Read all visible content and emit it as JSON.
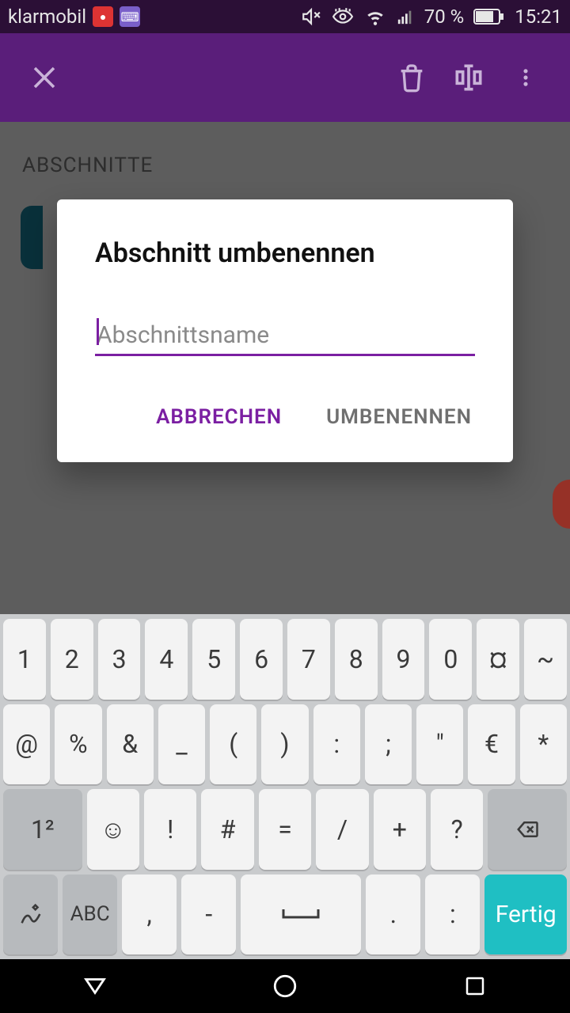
{
  "status": {
    "carrier": "klarmobil",
    "battery": "70 %",
    "time": "15:21"
  },
  "page": {
    "section_header": "ABSCHNITTE"
  },
  "dialog": {
    "title": "Abschnitt umbenennen",
    "placeholder": "Abschnittsname",
    "value": "",
    "cancel": "ABBRECHEN",
    "confirm": "UMBENENNEN"
  },
  "keyboard": {
    "row1": [
      "1",
      "2",
      "3",
      "4",
      "5",
      "6",
      "7",
      "8",
      "9",
      "0",
      "¤",
      "~"
    ],
    "row2": [
      "@",
      "%",
      "&",
      "_",
      "(",
      ")",
      ":",
      ";",
      "\"",
      "€",
      "*"
    ],
    "row3_left": "1²",
    "row3": [
      "☺",
      "!",
      "#",
      "=",
      "/",
      "+",
      "?"
    ],
    "row4_abc": "ABC",
    "row4": [
      ",",
      "-",
      " ",
      ".",
      ":"
    ],
    "done": "Fertig"
  }
}
